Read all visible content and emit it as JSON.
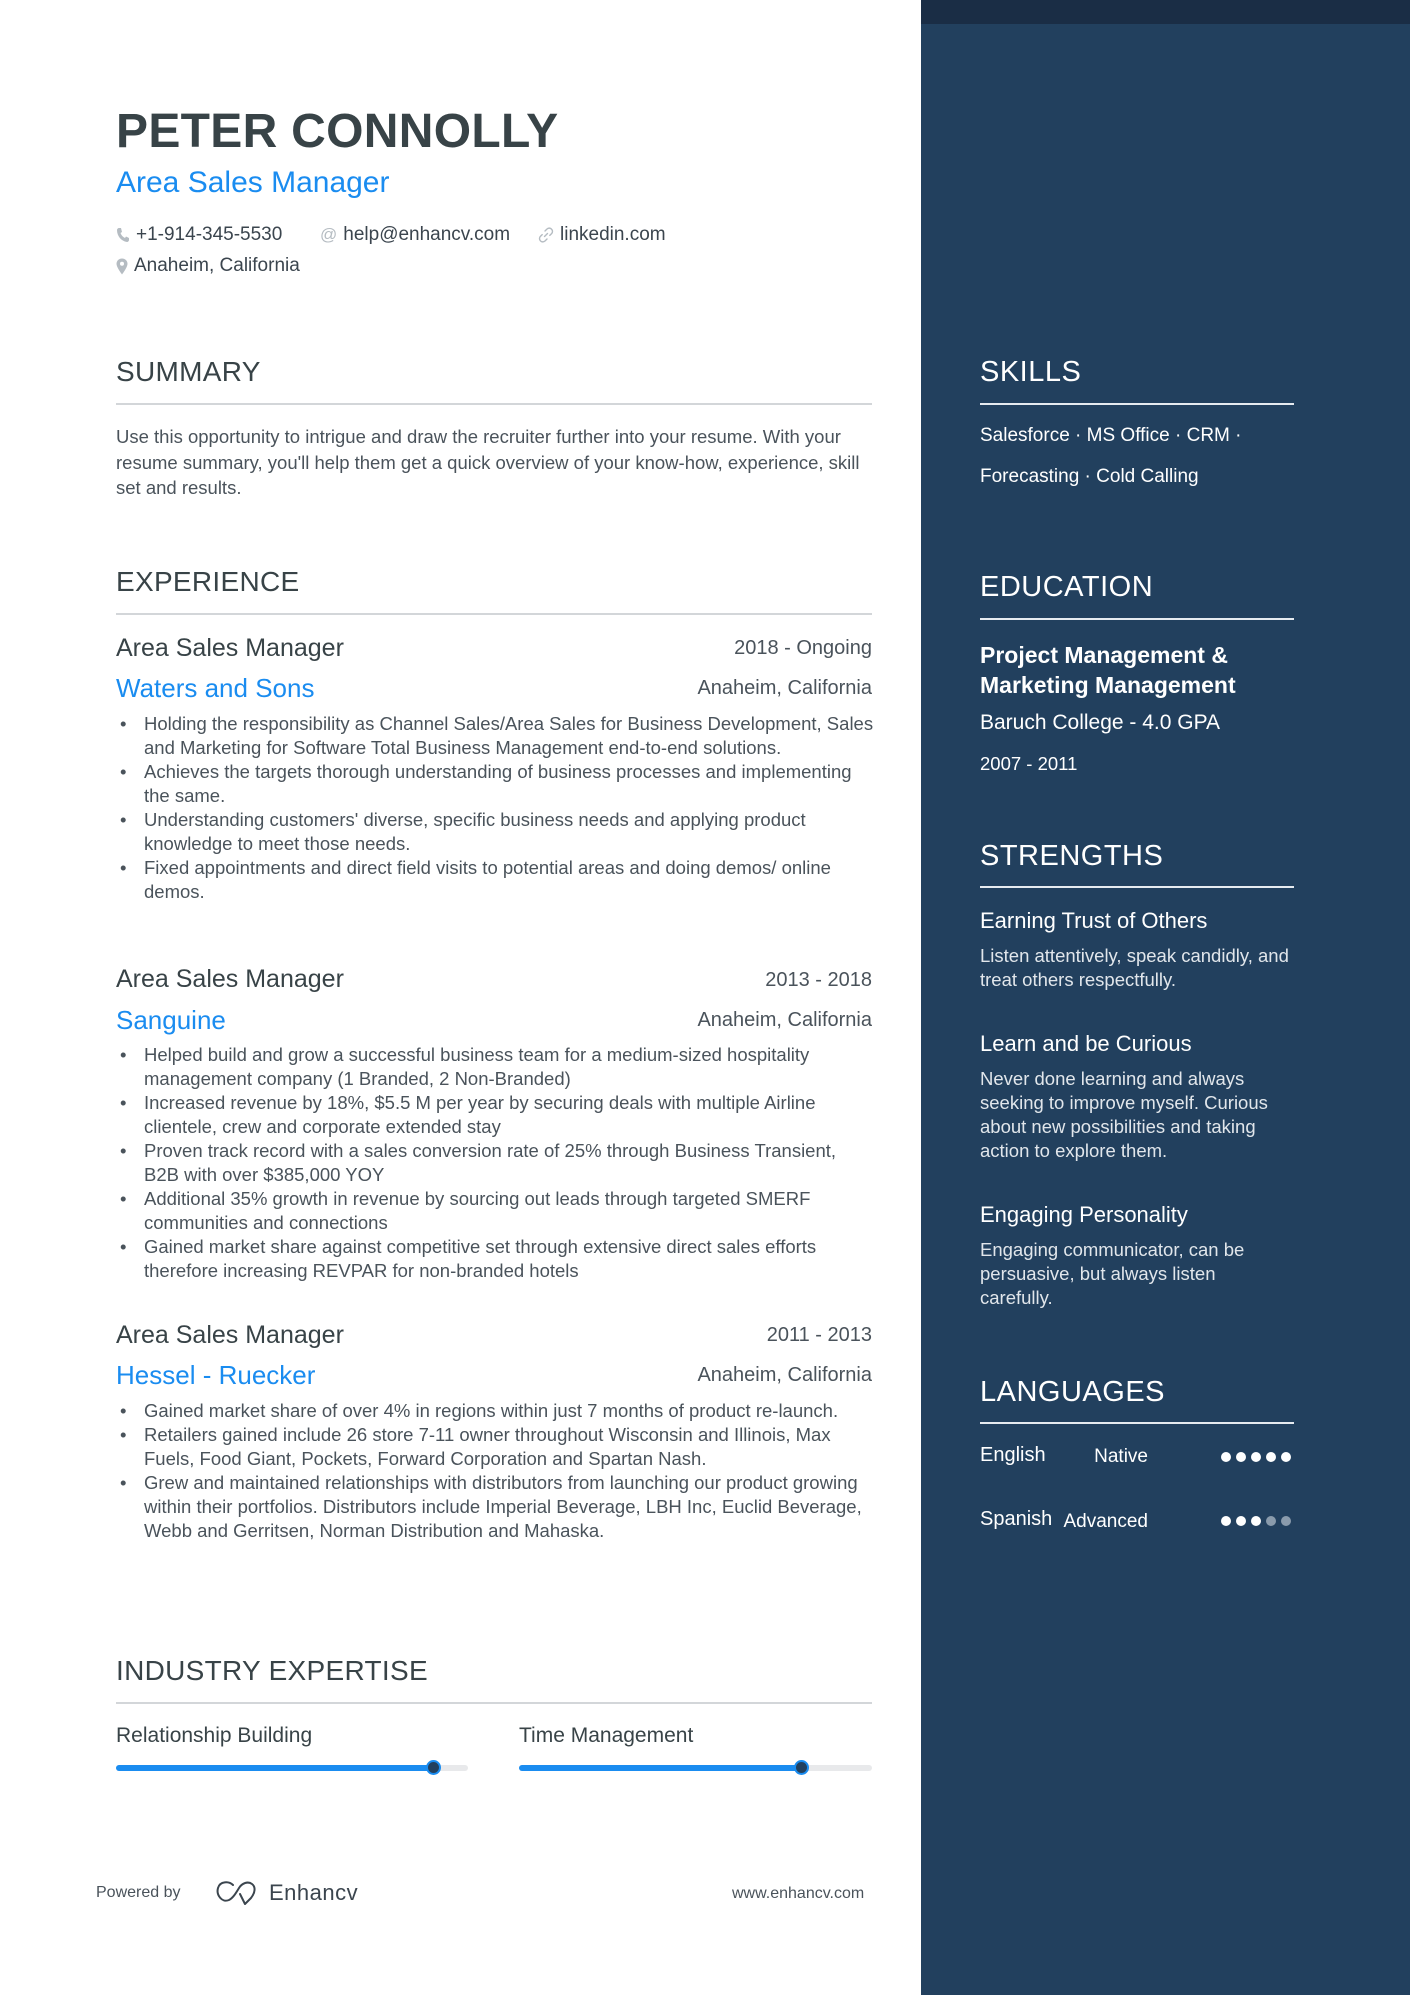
{
  "header": {
    "name": "PETER CONNOLLY",
    "title": "Area Sales Manager",
    "contacts": [
      {
        "icon": "phone-icon",
        "text": "+1-914-345-5530"
      },
      {
        "icon": "at-icon",
        "text": "help@enhancv.com"
      },
      {
        "icon": "link-icon",
        "text": "linkedin.com"
      },
      {
        "icon": "location-pin-icon",
        "text": "Anaheim, California"
      }
    ]
  },
  "summary": {
    "heading": "SUMMARY",
    "text": "Use this opportunity to intrigue and draw the recruiter further into your resume. With your resume summary, you'll help them get a quick overview of your know-how, experience, skill set and results."
  },
  "experience": {
    "heading": "EXPERIENCE",
    "jobs": [
      {
        "title": "Area Sales Manager",
        "dates": "2018 - Ongoing",
        "company": "Waters and Sons",
        "location": "Anaheim, California",
        "bullets": [
          "Holding the responsibility as Channel Sales/Area Sales for Business Development, Sales and Marketing for Software Total Business Management end-to-end solutions.",
          "Achieves the targets thorough understanding of business processes and implementing the same.",
          "Understanding customers' diverse, specific business needs and applying product knowledge to meet those needs.",
          "Fixed appointments and direct field visits to potential areas and doing demos/ online demos."
        ]
      },
      {
        "title": "Area Sales Manager",
        "dates": "2013 - 2018",
        "company": "Sanguine",
        "location": "Anaheim, California",
        "bullets": [
          "Helped build and grow a successful business team for a medium-sized hospitality management company (1 Branded, 2 Non-Branded)",
          "Increased revenue by 18%, $5.5 M per year by securing deals with multiple Airline clientele, crew and corporate extended stay",
          "Proven track record with a sales conversion rate of 25% through Business Transient, B2B with over $385,000 YOY",
          "Additional 35% growth in revenue by sourcing out leads through targeted SMERF communities and connections",
          "Gained market share against competitive set through extensive direct sales efforts therefore increasing REVPAR for non-branded hotels"
        ]
      },
      {
        "title": "Area Sales Manager",
        "dates": "2011 - 2013",
        "company": "Hessel - Ruecker",
        "location": "Anaheim, California",
        "bullets": [
          "Gained market share of over 4% in regions within just 7 months of product re-launch.",
          "Retailers gained include 26 store 7-11 owner throughout Wisconsin and Illinois, Max Fuels, Food Giant, Pockets, Forward Corporation and Spartan Nash.",
          "Grew and maintained relationships with distributors from launching our product growing within their portfolios. Distributors include Imperial Beverage, LBH Inc, Euclid Beverage, Webb and Gerritsen, Norman Distribution and Mahaska."
        ]
      }
    ]
  },
  "industry_expertise": {
    "heading": "INDUSTRY EXPERTISE",
    "items": [
      {
        "label": "Relationship Building",
        "level": 0.9
      },
      {
        "label": "Time Management",
        "level": 0.8
      }
    ]
  },
  "footer": {
    "powered_by": "Powered by",
    "brand": "Enhancv",
    "website": "www.enhancv.com"
  },
  "sidebar": {
    "skills": {
      "heading": "SKILLS",
      "line1": "Salesforce · MS Office · CRM ·",
      "line2": "Forecasting · Cold Calling",
      "items": [
        "Salesforce",
        "MS Office",
        "CRM",
        "Forecasting",
        "Cold Calling"
      ]
    },
    "education": {
      "heading": "EDUCATION",
      "degree_line1": "Project Management &",
      "degree_line2": "Marketing Management",
      "school": "Baruch College - 4.0 GPA",
      "dates": "2007 - 2011"
    },
    "strengths": {
      "heading": "STRENGTHS",
      "items": [
        {
          "title": "Earning Trust of Others",
          "description": "Listen attentively, speak candidly, and treat others respectfully."
        },
        {
          "title": "Learn and be Curious",
          "description": "Never done learning and always seeking to improve myself. Curious about new possibilities and taking action to explore them."
        },
        {
          "title": "Engaging Personality",
          "description": "Engaging communicator, can be persuasive, but always listen carefully."
        }
      ]
    },
    "languages": {
      "heading": "LANGUAGES",
      "items": [
        {
          "name": "English",
          "level": "Native",
          "rating": 5,
          "max": 5
        },
        {
          "name": "Spanish",
          "level": "Advanced",
          "rating": 3,
          "max": 5
        }
      ]
    }
  },
  "colors": {
    "accent": "#1a8cf0",
    "sidebar_bg": "#22405e",
    "sidebar_strip": "#1a2d45",
    "heading_text": "#384347"
  }
}
